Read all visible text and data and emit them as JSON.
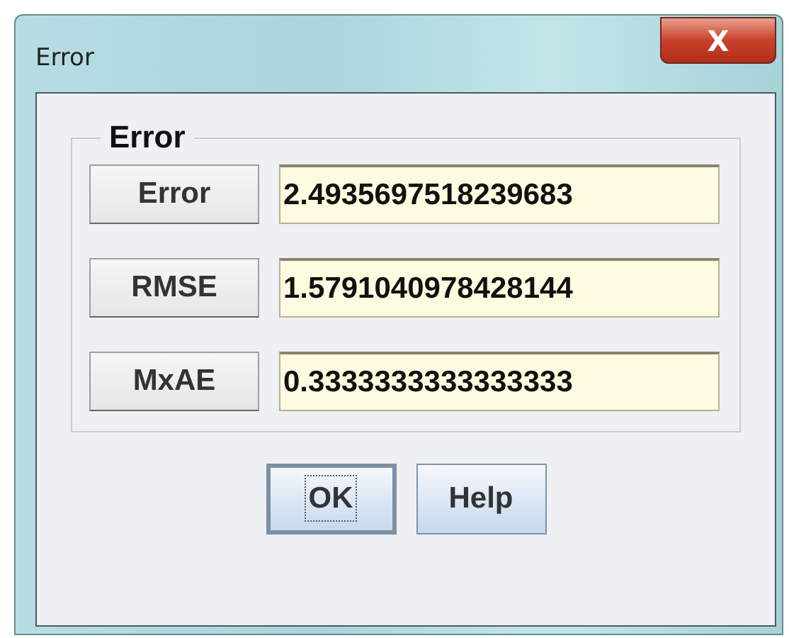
{
  "window": {
    "title": "Error",
    "close_label": "X"
  },
  "group": {
    "title": "Error",
    "rows": [
      {
        "label": "Error",
        "value": "2.4935697518239683"
      },
      {
        "label": "RMSE",
        "value": "1.5791040978428144"
      },
      {
        "label": "MxAE",
        "value": "0.3333333333333333"
      }
    ]
  },
  "buttons": [
    {
      "label": "OK",
      "focused": true
    },
    {
      "label": "Help",
      "focused": false
    }
  ]
}
